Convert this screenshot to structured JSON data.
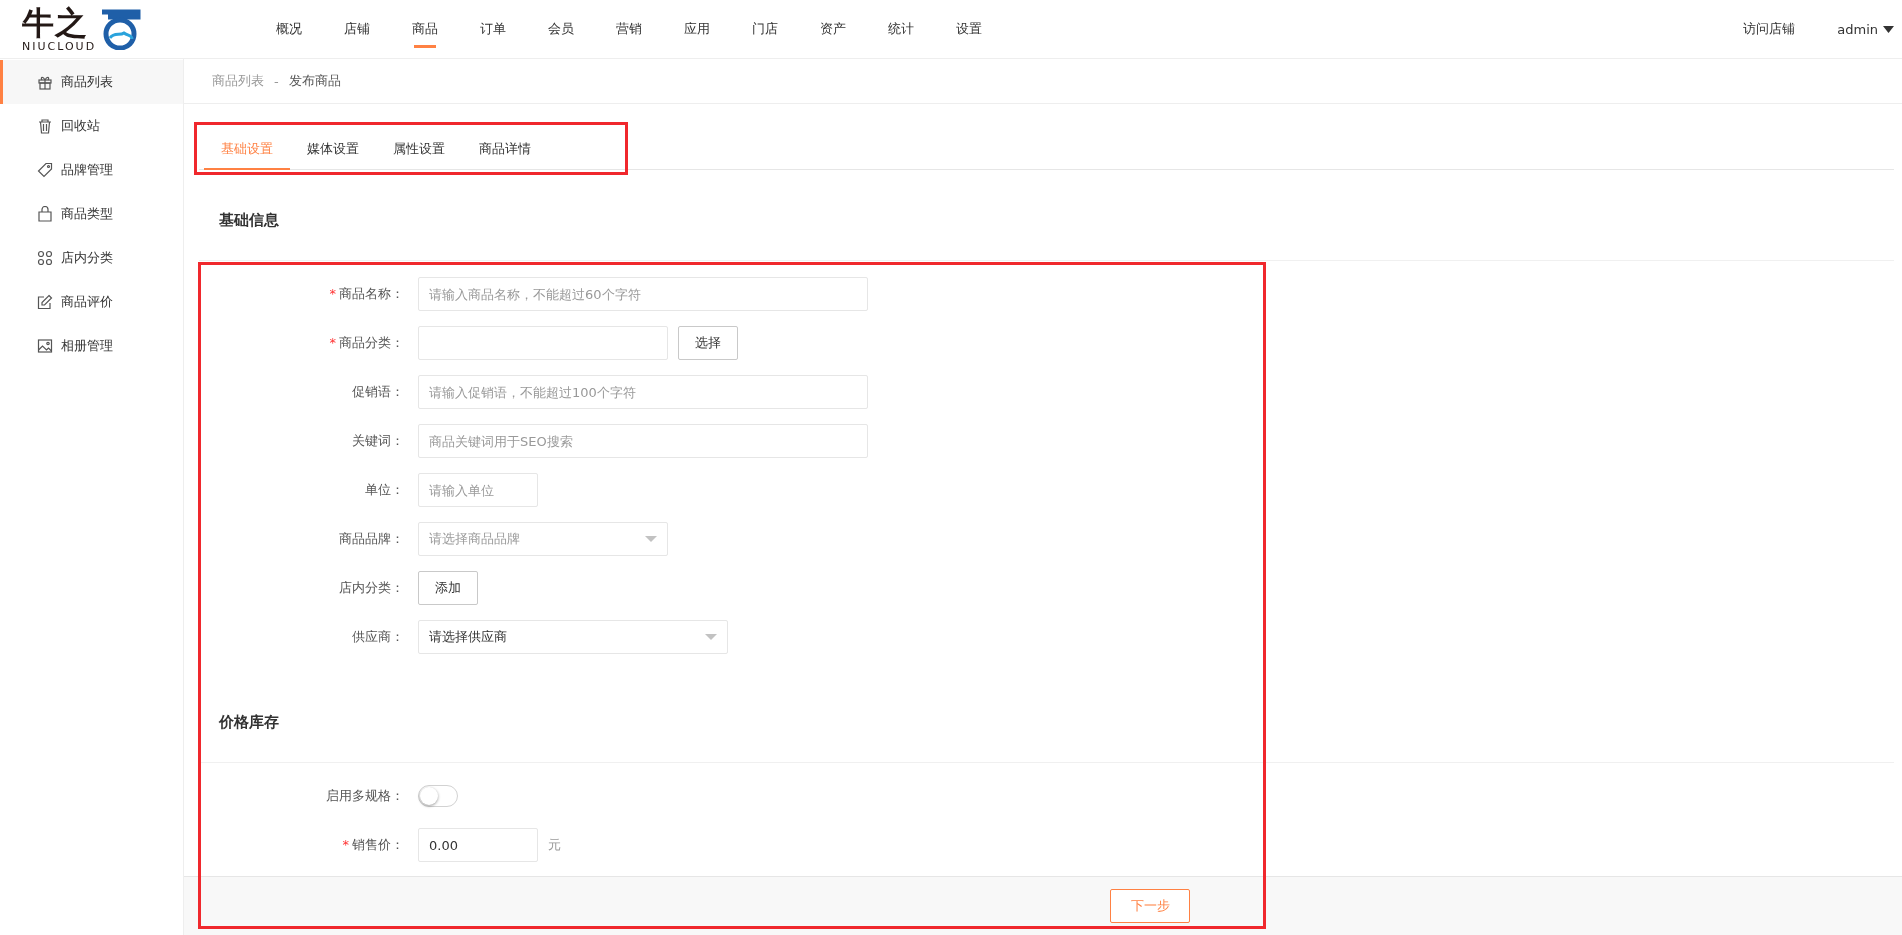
{
  "header": {
    "logo": {
      "mark": "牛之",
      "wordmark": "NIUCLOUD"
    },
    "nav": [
      {
        "label": "概况",
        "selected": false
      },
      {
        "label": "店铺",
        "selected": false
      },
      {
        "label": "商品",
        "selected": true
      },
      {
        "label": "订单",
        "selected": false
      },
      {
        "label": "会员",
        "selected": false
      },
      {
        "label": "营销",
        "selected": false
      },
      {
        "label": "应用",
        "selected": false
      },
      {
        "label": "门店",
        "selected": false
      },
      {
        "label": "资产",
        "selected": false
      },
      {
        "label": "统计",
        "selected": false
      },
      {
        "label": "设置",
        "selected": false
      }
    ],
    "visit_store": "访问店铺",
    "user": "admin"
  },
  "sidebar": {
    "items": [
      {
        "label": "商品列表",
        "selected": true
      },
      {
        "label": "回收站",
        "selected": false
      },
      {
        "label": "品牌管理",
        "selected": false
      },
      {
        "label": "商品类型",
        "selected": false
      },
      {
        "label": "店内分类",
        "selected": false
      },
      {
        "label": "商品评价",
        "selected": false
      },
      {
        "label": "相册管理",
        "selected": false
      }
    ]
  },
  "breadcrumb": {
    "parent": "商品列表",
    "separator": "-",
    "current": "发布商品"
  },
  "tabs": [
    {
      "label": "基础设置",
      "selected": true
    },
    {
      "label": "媒体设置",
      "selected": false
    },
    {
      "label": "属性设置",
      "selected": false
    },
    {
      "label": "商品详情",
      "selected": false
    }
  ],
  "sections": [
    {
      "title": "基础信息",
      "fields": [
        {
          "kind": "input",
          "label": "商品名称：",
          "required_mark": "*",
          "placeholder": "请输入商品名称，不能超过60个字符"
        },
        {
          "kind": "input_button",
          "label": "商品分类：",
          "required_mark": "*",
          "button": "选择"
        },
        {
          "kind": "input",
          "label": "促销语：",
          "placeholder": "请输入促销语，不能超过100个字符"
        },
        {
          "kind": "input",
          "label": "关键词：",
          "placeholder": "商品关键词用于SEO搜索"
        },
        {
          "kind": "input",
          "label": "单位：",
          "placeholder": "请输入单位"
        },
        {
          "kind": "select",
          "label": "商品品牌：",
          "placeholder": "请选择商品品牌"
        },
        {
          "kind": "button",
          "label": "店内分类：",
          "button": "添加"
        },
        {
          "kind": "select",
          "label": "供应商：",
          "value": "请选择供应商"
        }
      ]
    },
    {
      "title": "价格库存",
      "fields": [
        {
          "kind": "switch",
          "label": "启用多规格：",
          "on": false
        },
        {
          "kind": "input",
          "label": "销售价：",
          "required_mark": "*",
          "value": "0.00",
          "suffix": "元"
        }
      ]
    }
  ],
  "footer": {
    "next_button": "下一步"
  }
}
